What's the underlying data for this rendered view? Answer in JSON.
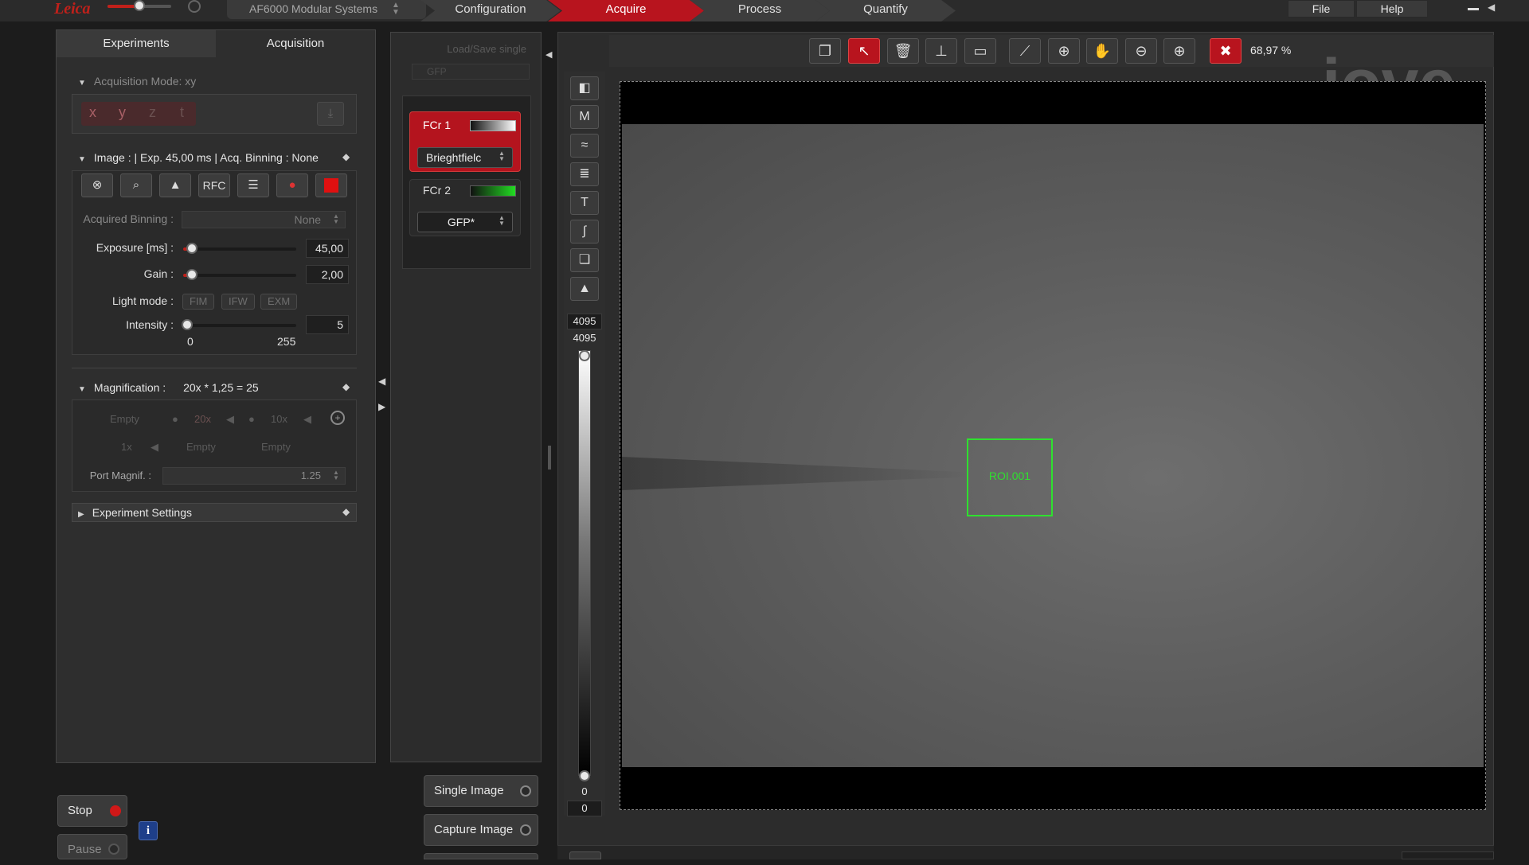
{
  "app": {
    "brand": "Leica",
    "system_name": "AF6000 Modular Systems"
  },
  "workflow_tabs": [
    "Configuration",
    "Acquire",
    "Process",
    "Quantify"
  ],
  "menu": {
    "file": "File",
    "help": "Help"
  },
  "left_panel": {
    "tabs": [
      "Experiments",
      "Acquisition"
    ],
    "acquisition_mode": "Acquisition Mode: xy",
    "axis_buttons": [
      "x",
      "y",
      "z",
      "t"
    ],
    "image_header": "Image : | Exp. 45,00 ms | Acq. Binning : None",
    "tool_buttons": {
      "rfc": "RFC"
    },
    "acquired_binning": {
      "label": "Acquired Binning :",
      "value": "None"
    },
    "exposure": {
      "label": "Exposure [ms] :",
      "value": "45,00",
      "level": 0.08
    },
    "gain": {
      "label": "Gain :",
      "value": "2,00",
      "level": 0.08
    },
    "light_mode": {
      "label": "Light mode :",
      "options": [
        "FIM",
        "IFW",
        "EXM"
      ]
    },
    "intensity": {
      "label": "Intensity :",
      "value": "5",
      "min": "0",
      "max": "255",
      "level": 0.02
    },
    "magnification": {
      "label": "Magnification :",
      "value": "20x * 1,25 = 25",
      "row1": [
        "Empty",
        "20x",
        "10x"
      ],
      "row2": [
        "1x",
        "Empty",
        "Empty"
      ]
    },
    "port_magnif": {
      "label": "Port Magnif. :",
      "value": "1.25"
    },
    "experiment_settings": "Experiment Settings"
  },
  "channel_panel": {
    "load_save": "Load/Save single",
    "preset": "GFP",
    "fc1": {
      "label": "FCr 1",
      "dropdown": "Brieghtfielc"
    },
    "fc2": {
      "label": "FCr 2",
      "dropdown": "GFP*"
    }
  },
  "viewer": {
    "zoom": "68,97 %",
    "roi_label": "ROI.001",
    "lut_max_top": "4095",
    "lut_max": "4095",
    "lut_min": "0",
    "lut_min_bottom": "0",
    "watermark": "jove"
  },
  "bottom": {
    "stop": "Stop",
    "pause": "Pause",
    "single_image": "Single Image",
    "capture_image": "Capture Image"
  },
  "colors": {
    "accent": "#b8141e",
    "roi": "#2fe02f",
    "fc2_gradient_end": "#22dd22"
  }
}
